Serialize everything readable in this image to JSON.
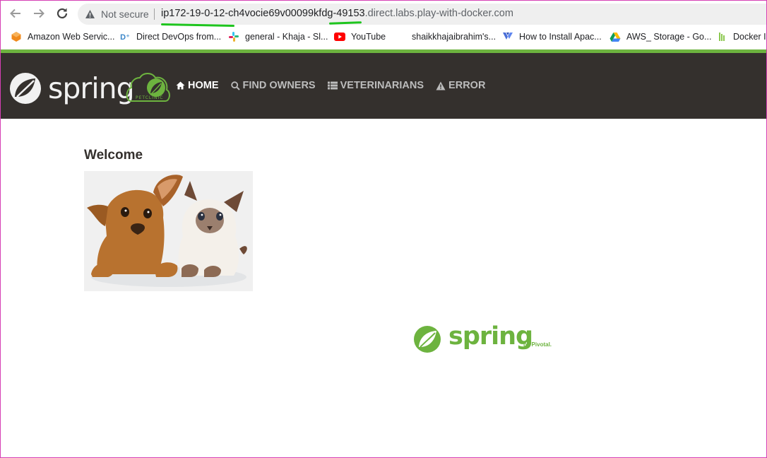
{
  "browser": {
    "security_label": "Not secure",
    "url_host": "ip172-19-0-12-ch4vocie69v00099kfdg-49153",
    "url_domain": ".direct.labs.play-with-docker.com",
    "icons": [
      "back-arrow-icon",
      "forward-arrow-icon",
      "reload-icon",
      "warning-icon"
    ],
    "bookmarks": [
      {
        "label": "Amazon Web Servic...",
        "icon": "aws-icon"
      },
      {
        "label": "Direct DevOps from...",
        "icon": "devops-icon"
      },
      {
        "label": "general - Khaja - Sl...",
        "icon": "slack-icon"
      },
      {
        "label": "YouTube",
        "icon": "youtube-icon"
      },
      {
        "label": "shaikkhajaibrahim's...",
        "icon": "blank-icon"
      },
      {
        "label": "How to Install Apac...",
        "icon": "vultr-icon"
      },
      {
        "label": "AWS_ Storage - Go...",
        "icon": "google-drive-icon"
      },
      {
        "label": "Docker In",
        "icon": "docker-icon"
      }
    ]
  },
  "navbar": {
    "brand": "spring",
    "pet_logo_text": "PETCLINIC",
    "menu": [
      {
        "label": "HOME",
        "icon": "home-icon",
        "active": true
      },
      {
        "label": "FIND OWNERS",
        "icon": "search-icon",
        "active": false
      },
      {
        "label": "VETERINARIANS",
        "icon": "list-icon",
        "active": false
      },
      {
        "label": "ERROR",
        "icon": "warning-icon",
        "active": false
      }
    ]
  },
  "main": {
    "heading": "Welcome",
    "image_alt": "puppy-and-kitten"
  },
  "footer": {
    "brand": "spring",
    "by_label": "by Pivotal."
  },
  "colors": {
    "spring_green": "#6db33f",
    "navbar_bg": "#34302d",
    "ink_green": "#1ec51e",
    "frame": "#d63fb5"
  }
}
